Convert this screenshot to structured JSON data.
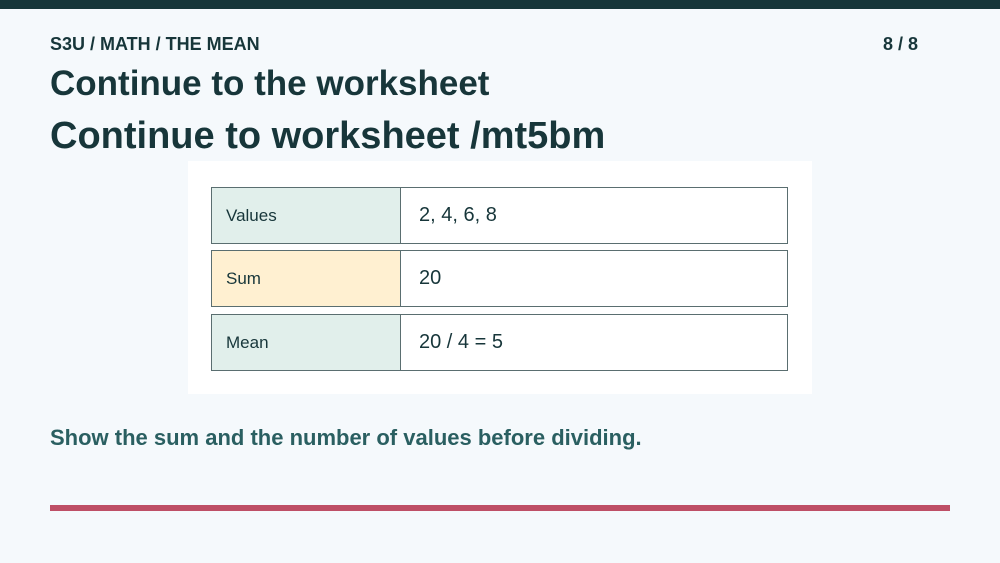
{
  "header": {
    "breadcrumb": "S3U / MATH / THE MEAN",
    "page_counter": "8 / 8"
  },
  "main": {
    "title": "Continue to the worksheet",
    "subtitle": "Continue to worksheet /mt5bm",
    "table": {
      "rows": [
        {
          "label": "Values",
          "value": "2, 4, 6, 8",
          "label_color": "#e1efeb"
        },
        {
          "label": "Sum",
          "value": "20",
          "label_color": "#fff0d1"
        },
        {
          "label": "Mean",
          "value": "20 / 4 = 5",
          "label_color": "#e1efeb"
        }
      ]
    },
    "note": "Show the sum and the number of values before dividing."
  },
  "colors": {
    "top_bar": "#17363a",
    "accent_line": "#be4f66",
    "note_text": "#2a5f61",
    "background": "#f5f9fc"
  }
}
